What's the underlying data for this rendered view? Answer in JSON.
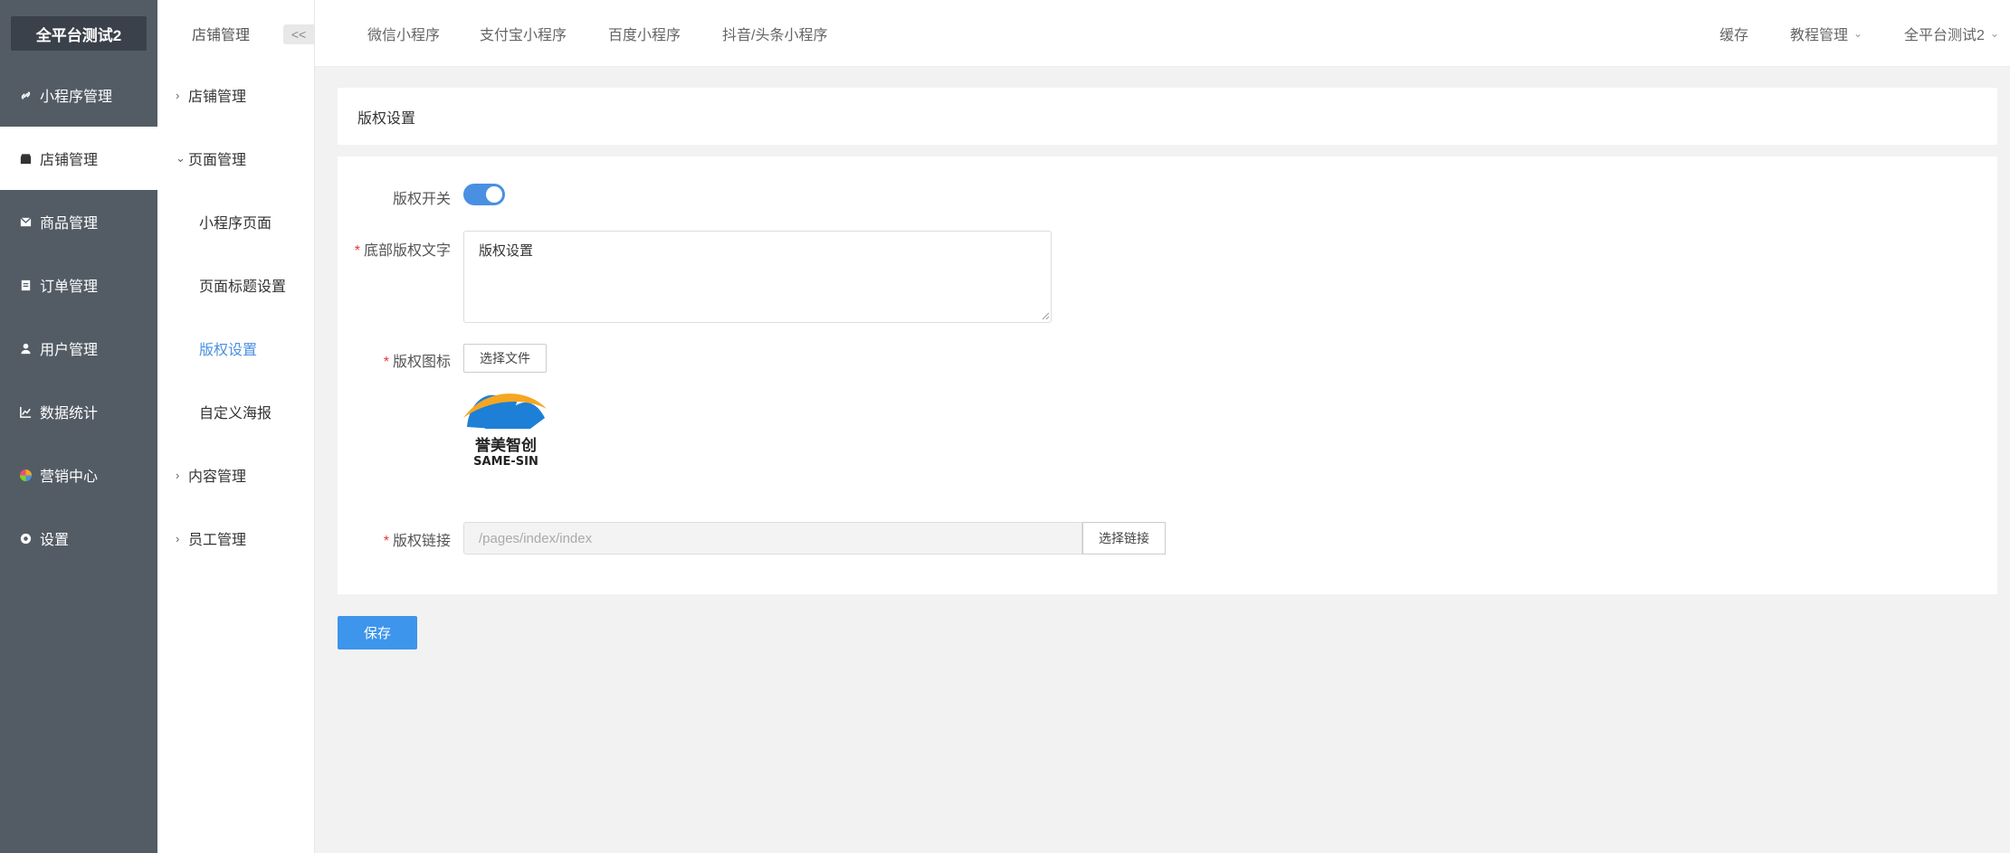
{
  "brand": "全平台测试2",
  "sidebar": {
    "items": [
      {
        "label": "小程序管理",
        "icon": "link-icon"
      },
      {
        "label": "店铺管理",
        "icon": "store-icon"
      },
      {
        "label": "商品管理",
        "icon": "mail-icon"
      },
      {
        "label": "订单管理",
        "icon": "clipboard-icon"
      },
      {
        "label": "用户管理",
        "icon": "user-icon"
      },
      {
        "label": "数据统计",
        "icon": "chart-icon"
      },
      {
        "label": "营销中心",
        "icon": "pinwheel-icon"
      },
      {
        "label": "设置",
        "icon": "gear-icon"
      }
    ]
  },
  "subnav": {
    "title": "店铺管理",
    "collapse": "<<",
    "items": [
      {
        "label": "店铺管理",
        "arrow": "›"
      },
      {
        "label": "页面管理",
        "arrow": "⌄"
      },
      {
        "label": "小程序页面"
      },
      {
        "label": "页面标题设置"
      },
      {
        "label": "版权设置"
      },
      {
        "label": "自定义海报"
      },
      {
        "label": "内容管理",
        "arrow": "›"
      },
      {
        "label": "员工管理",
        "arrow": "›"
      }
    ]
  },
  "topbar": {
    "tabs": [
      "微信小程序",
      "支付宝小程序",
      "百度小程序",
      "抖音/头条小程序"
    ],
    "right": [
      {
        "label": "缓存"
      },
      {
        "label": "教程管理",
        "dd": "⌄"
      },
      {
        "label": "全平台测试2",
        "dd": "⌄"
      }
    ]
  },
  "page": {
    "title": "版权设置"
  },
  "form": {
    "switch_label": "版权开关",
    "switch_on": true,
    "text_label": "底部版权文字",
    "text_value": "版权设置",
    "icon_label": "版权图标",
    "file_button": "选择文件",
    "logo_text": "誉美智创",
    "logo_sub": "SAME-SIN",
    "link_label": "版权链接",
    "link_value": "/pages/index/index",
    "link_button": "选择链接",
    "save": "保存"
  },
  "colors": {
    "sidebar_bg": "#535c65",
    "accent": "#3d95ec",
    "required": "#e53935"
  }
}
